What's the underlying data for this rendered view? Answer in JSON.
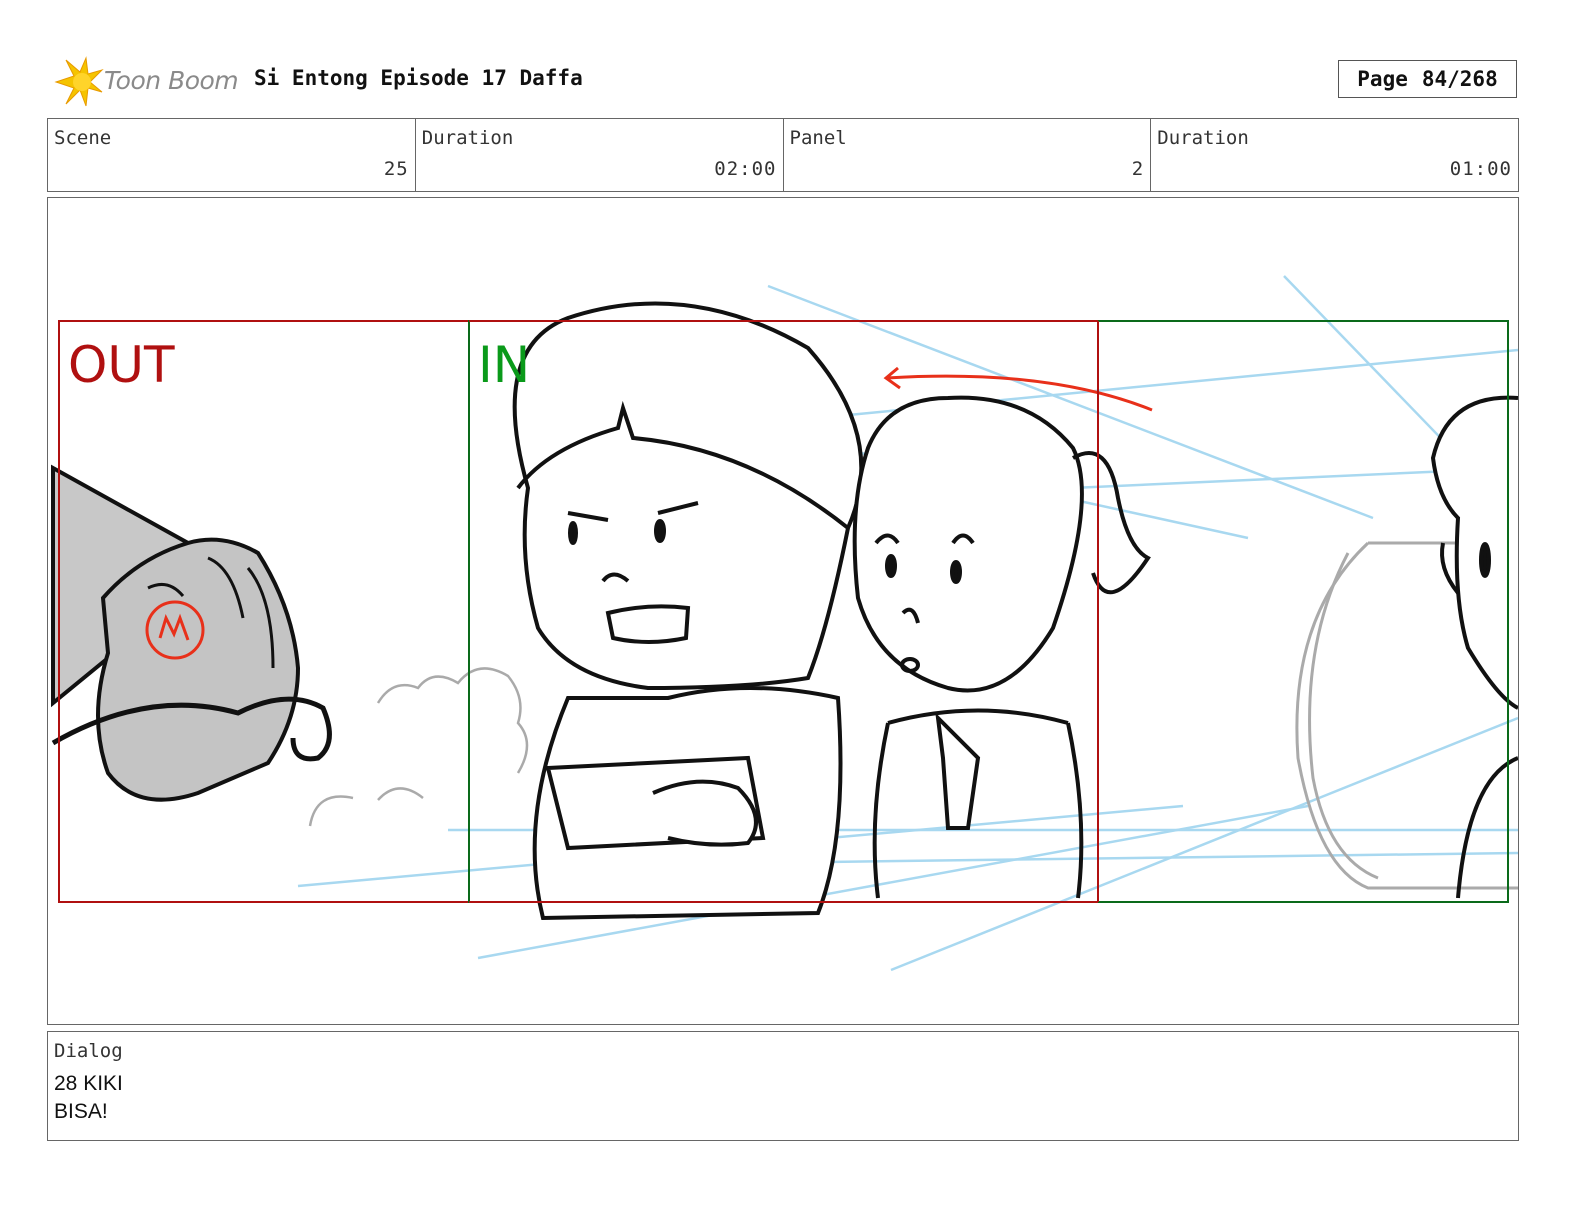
{
  "header": {
    "logo_text": "Toon Boom",
    "title": "Si Entong Episode 17 Daffa",
    "page_label": "Page",
    "page_value": "84/268"
  },
  "info": {
    "scene_label": "Scene",
    "scene_value": "25",
    "scene_duration_label": "Duration",
    "scene_duration_value": "02:00",
    "panel_label": "Panel",
    "panel_value": "2",
    "panel_duration_label": "Duration",
    "panel_duration_value": "01:00"
  },
  "frame": {
    "out_label": "OUT",
    "in_label": "IN",
    "out_color": "#b01010",
    "in_color": "#0a9a1a",
    "sketch_blue": "#a8d8f0",
    "arrow_color": "#e8301a"
  },
  "dialog": {
    "label": "Dialog",
    "lines": [
      "28 KIKI",
      "BISA!"
    ]
  }
}
